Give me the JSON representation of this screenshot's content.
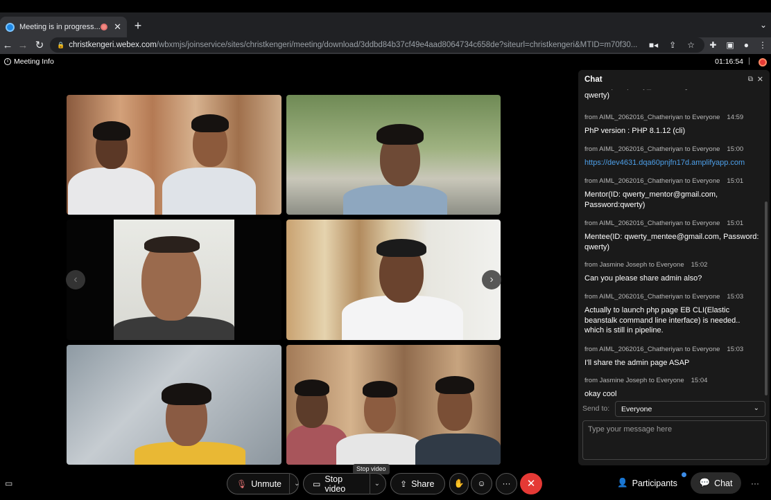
{
  "browser": {
    "tab_title": "Meeting is in progress...",
    "url_host": "christkengeri.webex.com",
    "url_path": "/wbxmjs/joinservice/sites/christkengeri/meeting/download/3ddbd84b37cf49e4aad8064734c658de?siteurl=christkengeri&MTID=m70f30..."
  },
  "meeting": {
    "info_label": "Meeting Info",
    "timer": "01:16:54"
  },
  "chat": {
    "title": "Chat",
    "partial_line_top": "Mentee(ID: qwerty_mentee@gmail.com, Password:",
    "partial_line": "qwerty)",
    "messages": [
      {
        "from": "from AIML_2062016_Chatheriyan to Everyone",
        "time": "14:59",
        "text": "PhP version : PHP 8.1.12 (cli)"
      },
      {
        "from": "from AIML_2062016_Chatheriyan to Everyone",
        "time": "15:00",
        "text": "https://dev4631.dqa60pnjfn17d.amplifyapp.com"
      },
      {
        "from": "from AIML_2062016_Chatheriyan to Everyone",
        "time": "15:01",
        "text": "Mentor(ID: qwerty_mentor@gmail.com, Password:qwerty)"
      },
      {
        "from": "from AIML_2062016_Chatheriyan to Everyone",
        "time": "15:01",
        "text": "Mentee(ID: qwerty_mentee@gmail.com, Password: qwerty)"
      },
      {
        "from": "from Jasmine Joseph to Everyone",
        "time": "15:02",
        "text": "Can you please share admin also?"
      },
      {
        "from": "from AIML_2062016_Chatheriyan to Everyone",
        "time": "15:03",
        "text": "Actually to launch php page EB CLI(Elastic beanstalk command line interface) is needed.. which is still in pipeline."
      },
      {
        "from": "from AIML_2062016_Chatheriyan to Everyone",
        "time": "15:03",
        "text": "I'll share the admin page ASAP"
      },
      {
        "from": "from Jasmine Joseph to Everyone",
        "time": "15:04",
        "text": "okay cool"
      }
    ],
    "send_to_label": "Send to:",
    "send_to_value": "Everyone",
    "input_placeholder": "Type your message here"
  },
  "controls": {
    "unmute": "Unmute",
    "stop_video": "Stop video",
    "stop_video_tooltip": "Stop video",
    "share": "Share",
    "participants": "Participants",
    "chat": "Chat"
  },
  "colors": {
    "end_call": "#e53935",
    "link": "#4d9fe8",
    "chat_panel": "#1a1a1a"
  }
}
